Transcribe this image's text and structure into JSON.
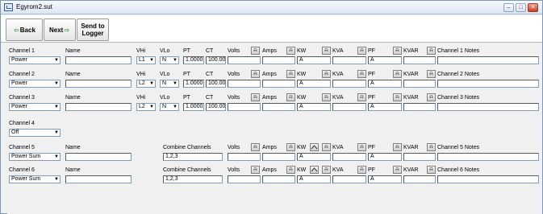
{
  "window": {
    "title": "Egyrom2.sut",
    "min_glyph": "–",
    "max_glyph": "□",
    "close_glyph": "✕"
  },
  "toolbar": {
    "back_label": "Back",
    "next_label": "Next",
    "send_label_1": "Send to",
    "send_label_2": "Logger",
    "back_arrow": "⇦",
    "next_arrow": "⇨"
  },
  "headers": {
    "name": "Name",
    "vhi": "VHi",
    "vlo": "VLo",
    "pt": "PT",
    "ct": "CT",
    "volts": "Volts",
    "amps": "Amps",
    "kw": "KW",
    "kva": "KVA",
    "pf": "PF",
    "kvar": "KVAR",
    "combine": "Combine Channels"
  },
  "alarm_glyph": "⍾",
  "channels": [
    {
      "label": "Channel 1",
      "type": "Power",
      "vhi": "L1",
      "vlo": "N",
      "pt": "1.0000",
      "ct": "100.000",
      "kw_unit": "A",
      "pf_unit": "A",
      "notes": "Channel 1 Notes"
    },
    {
      "label": "Channel 2",
      "type": "Power",
      "vhi": "L2",
      "vlo": "N",
      "pt": "1.0000",
      "ct": "100.000",
      "kw_unit": "A",
      "pf_unit": "A",
      "notes": "Channel 2 Notes"
    },
    {
      "label": "Channel 3",
      "type": "Power",
      "vhi": "L2",
      "vlo": "N",
      "pt": "1.0000",
      "ct": "100.000",
      "kw_unit": "A",
      "pf_unit": "A",
      "notes": "Channel 3 Notes"
    },
    {
      "label": "Channel 4",
      "type": "Off"
    },
    {
      "label": "Channel 5",
      "type": "Power Sum",
      "combine": "1,2,3",
      "kw_unit": "A",
      "pf_unit": "A",
      "notes": "Channel 5 Notes"
    },
    {
      "label": "Channel 6",
      "type": "Power Sum",
      "combine": "1,2,3",
      "kw_unit": "A",
      "pf_unit": "A",
      "notes": "Channel 6 Notes"
    }
  ],
  "colors": {
    "title_gradient_top": "#f6f9fd",
    "title_gradient_bottom": "#dbe6f3",
    "arrow_green": "#1e8a3a",
    "close_red": "#cc3b22"
  }
}
